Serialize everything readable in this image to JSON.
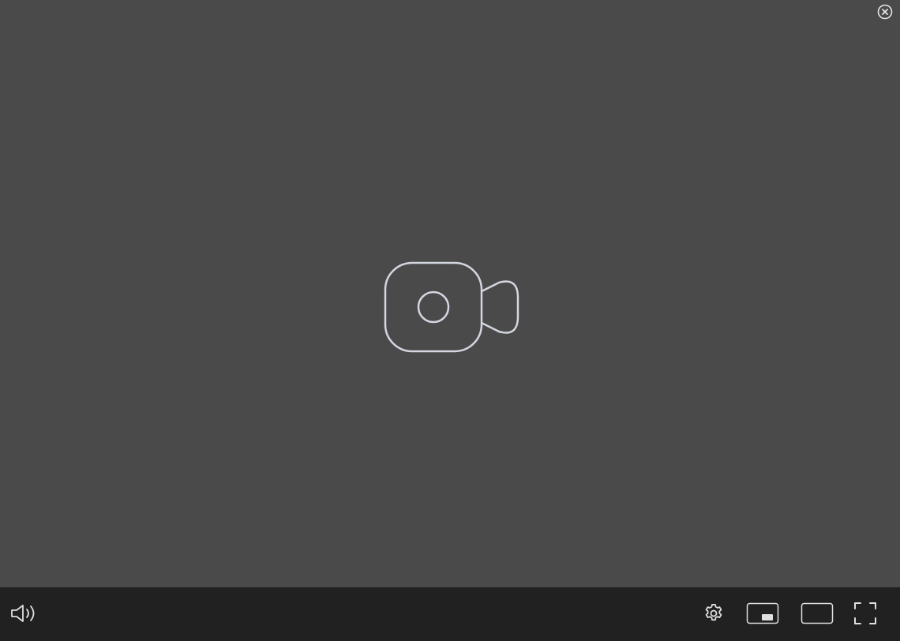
{
  "player": {
    "stage": {
      "background": "#4a4a4a",
      "placeholder_icon": "video-camera-icon",
      "placeholder_color": "#d4d6e0"
    },
    "close": {
      "icon": "close-circle-icon"
    },
    "toolbar": {
      "background": "#212121",
      "icon_color": "#e0e0e0",
      "left_controls": [
        {
          "name": "volume",
          "icon": "volume-icon"
        }
      ],
      "right_controls": [
        {
          "name": "settings",
          "icon": "gear-icon"
        },
        {
          "name": "picture-in-picture",
          "icon": "pip-icon"
        },
        {
          "name": "theater-mode",
          "icon": "theater-icon"
        },
        {
          "name": "fullscreen",
          "icon": "fullscreen-icon"
        }
      ]
    }
  }
}
